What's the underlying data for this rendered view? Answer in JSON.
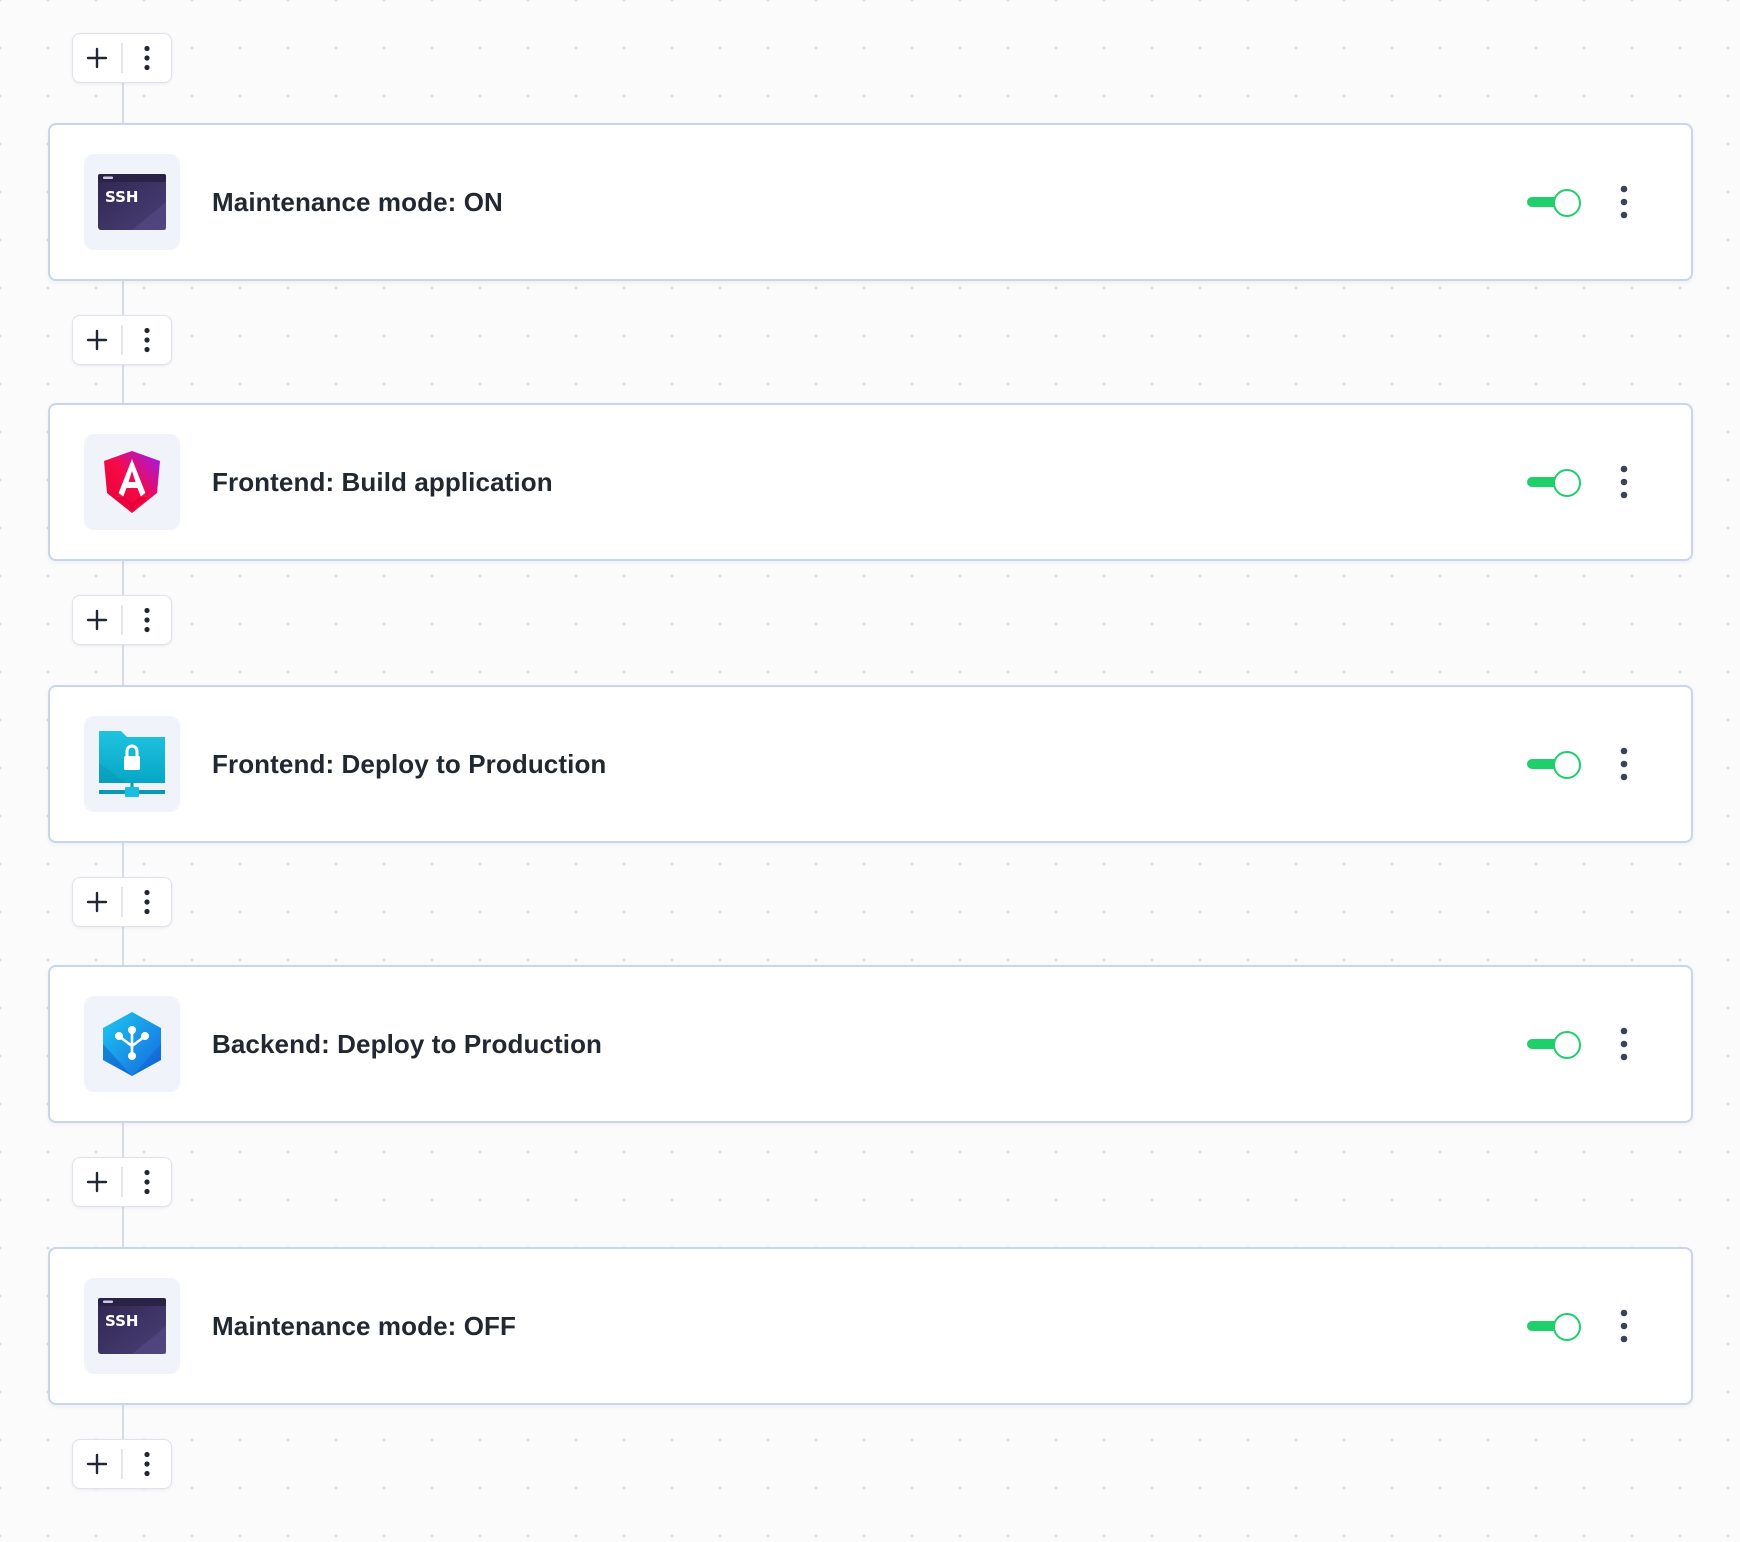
{
  "colors": {
    "toggle_on": "#1fcf6b",
    "card_border": "#c9d6ea",
    "icon_tile_bg": "#f0f3f9",
    "title_text": "#222831",
    "kebab_dot": "#3a4458"
  },
  "steps": [
    {
      "title": "Maintenance mode: ON",
      "icon": "ssh-terminal-icon",
      "icon_badge": "SSH",
      "enabled": true
    },
    {
      "title": "Frontend: Build application",
      "icon": "angular-icon",
      "enabled": true
    },
    {
      "title": "Frontend: Deploy to Production",
      "icon": "sftp-folder-lock-icon",
      "enabled": true
    },
    {
      "title": "Backend: Deploy to Production",
      "icon": "atomic-deploy-hexagon-icon",
      "enabled": true
    },
    {
      "title": "Maintenance mode: OFF",
      "icon": "ssh-terminal-icon",
      "icon_badge": "SSH",
      "enabled": true
    }
  ],
  "inserters": [
    {
      "add": "add-step-plus-icon",
      "more": "more-options-icon"
    },
    {
      "add": "add-step-plus-icon",
      "more": "more-options-icon"
    },
    {
      "add": "add-step-plus-icon",
      "more": "more-options-icon"
    },
    {
      "add": "add-step-plus-icon",
      "more": "more-options-icon"
    },
    {
      "add": "add-step-plus-icon",
      "more": "more-options-icon"
    },
    {
      "add": "add-step-plus-icon",
      "more": "more-options-icon"
    }
  ]
}
